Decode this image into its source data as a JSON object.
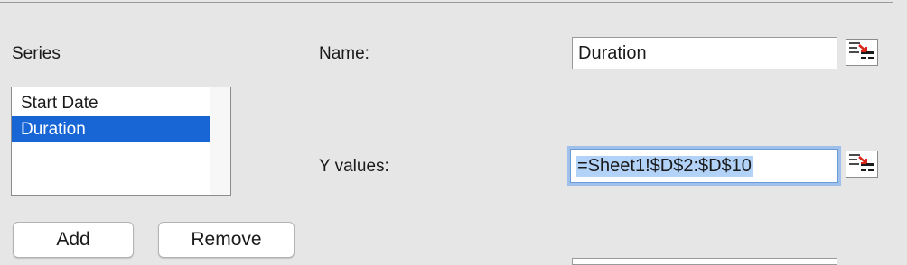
{
  "series_section": {
    "label": "Series",
    "items": [
      {
        "label": "Start Date",
        "selected": false
      },
      {
        "label": "Duration",
        "selected": true
      }
    ],
    "add_label": "Add",
    "remove_label": "Remove"
  },
  "name": {
    "label": "Name:",
    "value": "Duration",
    "ref_icon": "range-select-icon"
  },
  "y_values": {
    "label": "Y values:",
    "value": "=Sheet1!$D$2:$D$10",
    "ref_icon": "range-select-icon"
  },
  "colors": {
    "selection": "#1866d6",
    "focus_ring": "#9ec0ea",
    "text_highlight": "#b3d2f8",
    "ref_icon_red": "#d9261c"
  }
}
